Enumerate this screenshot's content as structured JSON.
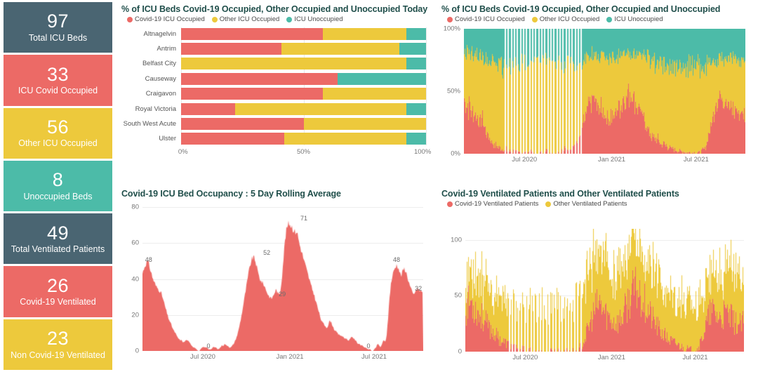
{
  "kpis": [
    {
      "value": "97",
      "label": "Total ICU Beds",
      "color": "#4a6572"
    },
    {
      "value": "33",
      "label": "ICU Covid Occupied",
      "color": "#ec6a66"
    },
    {
      "value": "56",
      "label": "Other ICU Occupied",
      "color": "#edc93c"
    },
    {
      "value": "8",
      "label": "Unoccupied Beds",
      "color": "#4cbba8"
    },
    {
      "value": "49",
      "label": "Total Ventilated Patients",
      "color": "#4a6572"
    },
    {
      "value": "26",
      "label": "Covid-19 Ventilated",
      "color": "#ec6a66"
    },
    {
      "value": "23",
      "label": "Non Covid-19 Ventilated",
      "color": "#edc93c"
    }
  ],
  "colors": {
    "covid": "#ec6a66",
    "other": "#edc93c",
    "unoccupied": "#4cbba8",
    "slate": "#4a6572",
    "title": "#1f4e4a"
  },
  "panel_hbar": {
    "title": "% of ICU Beds Covid-19 Occupied, Other Occupied and Unoccupied Today",
    "legend": [
      {
        "label": "Covid-19 ICU Occupied",
        "color": "#ec6a66"
      },
      {
        "label": "Other ICU Occupied",
        "color": "#edc93c"
      },
      {
        "label": "ICU Unoccupied",
        "color": "#4cbba8"
      }
    ]
  },
  "panel_pct_ts": {
    "title": "% of ICU Beds Covid-19 Occupied, Other Occupied and Unoccupied",
    "legend": [
      {
        "label": "Covid-19 ICU Occupied",
        "color": "#ec6a66"
      },
      {
        "label": "Other ICU Occupied",
        "color": "#edc93c"
      },
      {
        "label": "ICU Unoccupied",
        "color": "#4cbba8"
      }
    ]
  },
  "panel_rolling": {
    "title": "Covid-19 ICU Bed Occupancy : 5 Day Rolling Average"
  },
  "panel_vent": {
    "title": "Covid-19 Ventilated Patients and Other Ventilated Patients",
    "legend": [
      {
        "label": "Covid-19 Ventilated Patients",
        "color": "#ec6a66"
      },
      {
        "label": "Other Ventilated Patients",
        "color": "#edc93c"
      }
    ]
  },
  "chart_data": [
    {
      "id": "icu_beds_today",
      "type": "bar",
      "orientation": "horizontal",
      "stacked": true,
      "normalized": true,
      "title": "% of ICU Beds Covid-19 Occupied, Other Occupied and Unoccupied Today",
      "xlabel": "",
      "ylabel": "",
      "xlim": [
        0,
        100
      ],
      "xticks": [
        "0%",
        "50%",
        "100%"
      ],
      "xtick_values": [
        0,
        50,
        100
      ],
      "grid": true,
      "legend_position": "top-left",
      "categories": [
        "Altnagelvin",
        "Antrim",
        "Belfast City",
        "Causeway",
        "Craigavon",
        "Royal Victoria",
        "South West Acute",
        "Ulster"
      ],
      "series": [
        {
          "name": "Covid-19 ICU Occupied",
          "color": "#ec6a66",
          "values": [
            58,
            41,
            0,
            64,
            58,
            22,
            50,
            42
          ]
        },
        {
          "name": "Other ICU Occupied",
          "color": "#edc93c",
          "values": [
            34,
            48,
            92,
            0,
            42,
            70,
            50,
            50
          ]
        },
        {
          "name": "ICU Unoccupied",
          "color": "#4cbba8",
          "values": [
            8,
            11,
            8,
            36,
            0,
            8,
            0,
            8
          ]
        }
      ]
    },
    {
      "id": "icu_beds_pct_timeseries",
      "type": "area",
      "stacked": true,
      "normalized": true,
      "title": "% of ICU Beds Covid-19 Occupied, Other Occupied and Unoccupied",
      "xlabel": "",
      "ylabel": "",
      "ylim": [
        0,
        100
      ],
      "yticks": [
        "0%",
        "50%",
        "100%"
      ],
      "ytick_values": [
        0,
        50,
        100
      ],
      "xticks": [
        "Jul 2020",
        "Jan 2021",
        "Jul 2021"
      ],
      "xtick_positions": [
        0.215,
        0.525,
        0.825
      ],
      "grid": false,
      "legend_position": "top-left",
      "note": "Daily columns Apr 2020 - Oct 2021; white vertical gaps indicate missing days in mid 2020",
      "series": [
        {
          "name": "Covid-19 ICU Occupied",
          "color": "#ec6a66",
          "values": [
            40,
            38,
            37,
            35,
            33,
            30,
            28,
            27,
            26,
            22,
            18,
            15,
            12,
            9,
            7,
            6,
            5,
            4,
            4,
            3,
            3,
            2,
            2,
            2,
            1,
            1,
            1,
            1,
            1,
            2,
            2,
            2,
            1,
            1,
            1,
            1,
            2,
            2,
            2,
            2,
            1,
            1,
            2,
            2,
            2,
            3,
            3,
            4,
            5,
            5,
            6,
            8,
            10,
            14,
            18,
            24,
            30,
            36,
            40,
            44,
            42,
            38,
            36,
            34,
            32,
            30,
            30,
            29,
            30,
            31,
            33,
            36,
            39,
            42,
            44,
            46,
            48,
            47,
            45,
            42,
            38,
            34,
            30,
            26,
            22,
            18,
            15,
            13,
            11,
            10,
            9,
            8,
            7,
            6,
            5,
            4,
            4,
            3,
            3,
            2,
            2,
            2,
            1,
            1,
            1,
            1,
            1,
            1,
            1,
            2,
            3,
            6,
            12,
            20,
            28,
            36,
            42,
            45,
            46,
            44,
            42,
            40,
            38,
            36,
            35,
            34,
            34,
            33,
            33,
            34
          ]
        },
        {
          "name": "Other ICU Occupied",
          "color": "#edc93c",
          "values": [
            42,
            44,
            45,
            46,
            47,
            49,
            51,
            52,
            53,
            56,
            59,
            61,
            62,
            64,
            65,
            66,
            67,
            67,
            68,
            68,
            69,
            69,
            70,
            70,
            71,
            71,
            72,
            72,
            72,
            71,
            71,
            71,
            72,
            72,
            72,
            72,
            71,
            71,
            71,
            71,
            72,
            72,
            71,
            71,
            71,
            70,
            70,
            69,
            68,
            68,
            67,
            65,
            63,
            59,
            55,
            49,
            44,
            40,
            37,
            34,
            36,
            40,
            42,
            44,
            45,
            47,
            47,
            48,
            47,
            46,
            45,
            42,
            40,
            37,
            35,
            34,
            32,
            33,
            35,
            38,
            41,
            45,
            48,
            52,
            55,
            58,
            60,
            61,
            62,
            63,
            64,
            64,
            65,
            65,
            66,
            67,
            67,
            68,
            68,
            68,
            69,
            69,
            70,
            70,
            70,
            70,
            70,
            70,
            70,
            69,
            68,
            65,
            60,
            53,
            46,
            39,
            34,
            31,
            30,
            32,
            34,
            36,
            38,
            40,
            41,
            42,
            42,
            43,
            43,
            42
          ]
        },
        {
          "name": "ICU Unoccupied",
          "color": "#4cbba8",
          "values": [
            18,
            18,
            18,
            19,
            20,
            21,
            21,
            21,
            21,
            22,
            23,
            24,
            26,
            27,
            28,
            28,
            28,
            29,
            28,
            29,
            28,
            29,
            28,
            28,
            28,
            28,
            27,
            27,
            27,
            27,
            27,
            27,
            27,
            27,
            27,
            27,
            27,
            27,
            27,
            27,
            27,
            27,
            27,
            27,
            27,
            27,
            27,
            27,
            27,
            27,
            27,
            27,
            27,
            27,
            27,
            27,
            26,
            24,
            23,
            22,
            22,
            22,
            22,
            22,
            23,
            23,
            23,
            23,
            23,
            23,
            22,
            22,
            21,
            21,
            21,
            20,
            20,
            20,
            20,
            20,
            21,
            21,
            22,
            22,
            23,
            24,
            25,
            26,
            27,
            27,
            27,
            28,
            28,
            29,
            29,
            29,
            29,
            29,
            29,
            30,
            29,
            29,
            29,
            29,
            29,
            29,
            29,
            29,
            29,
            29,
            29,
            29,
            28,
            27,
            26,
            25,
            24,
            24,
            24,
            24,
            24,
            24,
            24,
            24,
            24,
            24,
            24,
            24,
            24,
            24
          ]
        }
      ]
    },
    {
      "id": "icu_rolling_avg",
      "type": "area",
      "stacked": false,
      "title": "Covid-19 ICU Bed Occupancy : 5 Day Rolling Average",
      "xlabel": "",
      "ylabel": "",
      "ylim": [
        0,
        80
      ],
      "yticks": [
        "0",
        "20",
        "40",
        "60",
        "80"
      ],
      "ytick_values": [
        0,
        20,
        40,
        60,
        80
      ],
      "xticks": [
        "Jul 2020",
        "Jan 2021",
        "Jul 2021"
      ],
      "xtick_positions": [
        0.215,
        0.525,
        0.825
      ],
      "grid": true,
      "color": "#ec6a66",
      "data_labels": [
        {
          "text": "48",
          "x_frac": 0.022,
          "value": 48
        },
        {
          "text": "0",
          "x_frac": 0.235,
          "value": 0
        },
        {
          "text": "52",
          "x_frac": 0.443,
          "value": 52
        },
        {
          "text": "29",
          "x_frac": 0.498,
          "value": 29
        },
        {
          "text": "71",
          "x_frac": 0.575,
          "value": 71
        },
        {
          "text": "0",
          "x_frac": 0.805,
          "value": 0
        },
        {
          "text": "48",
          "x_frac": 0.905,
          "value": 48
        },
        {
          "text": "32",
          "x_frac": 0.983,
          "value": 32
        }
      ],
      "values": [
        43,
        46,
        48,
        50,
        49,
        46,
        43,
        40,
        38,
        36,
        35,
        34,
        33,
        31,
        28,
        25,
        22,
        19,
        17,
        15,
        13,
        11,
        10,
        8,
        7,
        6,
        6,
        5,
        5,
        6,
        6,
        5,
        4,
        3,
        2,
        2,
        1,
        0,
        0,
        1,
        2,
        2,
        2,
        2,
        1,
        1,
        1,
        2,
        2,
        2,
        1,
        1,
        2,
        3,
        3,
        4,
        3,
        3,
        2,
        2,
        3,
        4,
        6,
        8,
        11,
        15,
        19,
        24,
        29,
        34,
        39,
        44,
        48,
        51,
        52,
        51,
        48,
        44,
        41,
        39,
        38,
        37,
        35,
        33,
        31,
        30,
        29,
        30,
        32,
        34,
        33,
        31,
        33,
        40,
        50,
        60,
        67,
        70,
        71,
        70,
        69,
        67,
        66,
        67,
        63,
        59,
        56,
        53,
        50,
        47,
        44,
        41,
        38,
        35,
        33,
        30,
        27,
        24,
        21,
        18,
        16,
        15,
        14,
        13,
        14,
        17,
        16,
        14,
        12,
        11,
        10,
        9,
        9,
        8,
        8,
        7,
        7,
        6,
        6,
        7,
        8,
        7,
        6,
        5,
        4,
        4,
        3,
        3,
        2,
        2,
        1,
        1,
        1,
        0,
        0,
        1,
        2,
        4,
        3,
        2,
        4,
        6,
        5,
        8,
        18,
        30,
        38,
        42,
        45,
        47,
        48,
        46,
        43,
        42,
        45,
        46,
        44,
        41,
        38,
        35,
        33,
        31,
        33,
        34,
        35,
        33,
        34,
        32
      ]
    },
    {
      "id": "ventilated_patients",
      "type": "area",
      "stacked": true,
      "title": "Covid-19 Ventilated Patients and Other Ventilated Patients",
      "xlabel": "",
      "ylabel": "",
      "ylim": [
        0,
        110
      ],
      "yticks": [
        "0",
        "50",
        "100"
      ],
      "ytick_values": [
        0,
        50,
        100
      ],
      "xticks": [
        "Jul 2020",
        "Jan 2021",
        "Jul 2021"
      ],
      "xtick_positions": [
        0.215,
        0.525,
        0.825
      ],
      "grid": true,
      "legend_position": "top-left",
      "series": [
        {
          "name": "Covid-19 Ventilated Patients",
          "color": "#ec6a66",
          "values": [
            38,
            42,
            45,
            44,
            41,
            38,
            35,
            33,
            31,
            28,
            25,
            22,
            20,
            18,
            16,
            14,
            12,
            10,
            9,
            8,
            7,
            6,
            5,
            5,
            4,
            4,
            3,
            3,
            2,
            2,
            2,
            2,
            1,
            1,
            1,
            1,
            1,
            1,
            0,
            0,
            1,
            1,
            1,
            1,
            1,
            1,
            1,
            1,
            1,
            1,
            1,
            1,
            1,
            2,
            3,
            5,
            8,
            12,
            17,
            22,
            28,
            33,
            38,
            41,
            43,
            40,
            37,
            34,
            32,
            30,
            28,
            27,
            26,
            27,
            29,
            32,
            36,
            41,
            46,
            50,
            53,
            55,
            56,
            54,
            51,
            47,
            43,
            39,
            35,
            31,
            28,
            25,
            22,
            19,
            17,
            15,
            13,
            11,
            10,
            9,
            8,
            7,
            6,
            5,
            4,
            3,
            3,
            2,
            2,
            2,
            2,
            3,
            6,
            12,
            18,
            24,
            30,
            34,
            36,
            35,
            33,
            31,
            30,
            31,
            33,
            34,
            32,
            30,
            28,
            26,
            25,
            24,
            25,
            26
          ]
        },
        {
          "name": "Other Ventilated Patients",
          "color": "#edc93c",
          "values": [
            25,
            27,
            28,
            29,
            30,
            32,
            34,
            35,
            33,
            32,
            34,
            36,
            35,
            33,
            32,
            34,
            36,
            38,
            37,
            35,
            33,
            32,
            34,
            36,
            38,
            37,
            35,
            34,
            36,
            38,
            40,
            39,
            37,
            36,
            38,
            40,
            42,
            41,
            39,
            38,
            40,
            42,
            44,
            43,
            41,
            40,
            42,
            44,
            46,
            45,
            43,
            42,
            44,
            46,
            48,
            47,
            45,
            44,
            46,
            48,
            50,
            49,
            47,
            45,
            43,
            42,
            44,
            46,
            45,
            43,
            42,
            44,
            46,
            48,
            47,
            45,
            43,
            42,
            44,
            46,
            48,
            47,
            45,
            44,
            42,
            41,
            40,
            42,
            44,
            43,
            41,
            40,
            42,
            44,
            43,
            41,
            40,
            42,
            44,
            43,
            41,
            40,
            42,
            44,
            43,
            41,
            40,
            42,
            44,
            43,
            42,
            40,
            38,
            37,
            36,
            35,
            34,
            36,
            38,
            40,
            42,
            44,
            43,
            41,
            40,
            42,
            44,
            43,
            41,
            40,
            42,
            44,
            43,
            41
          ]
        }
      ]
    }
  ]
}
